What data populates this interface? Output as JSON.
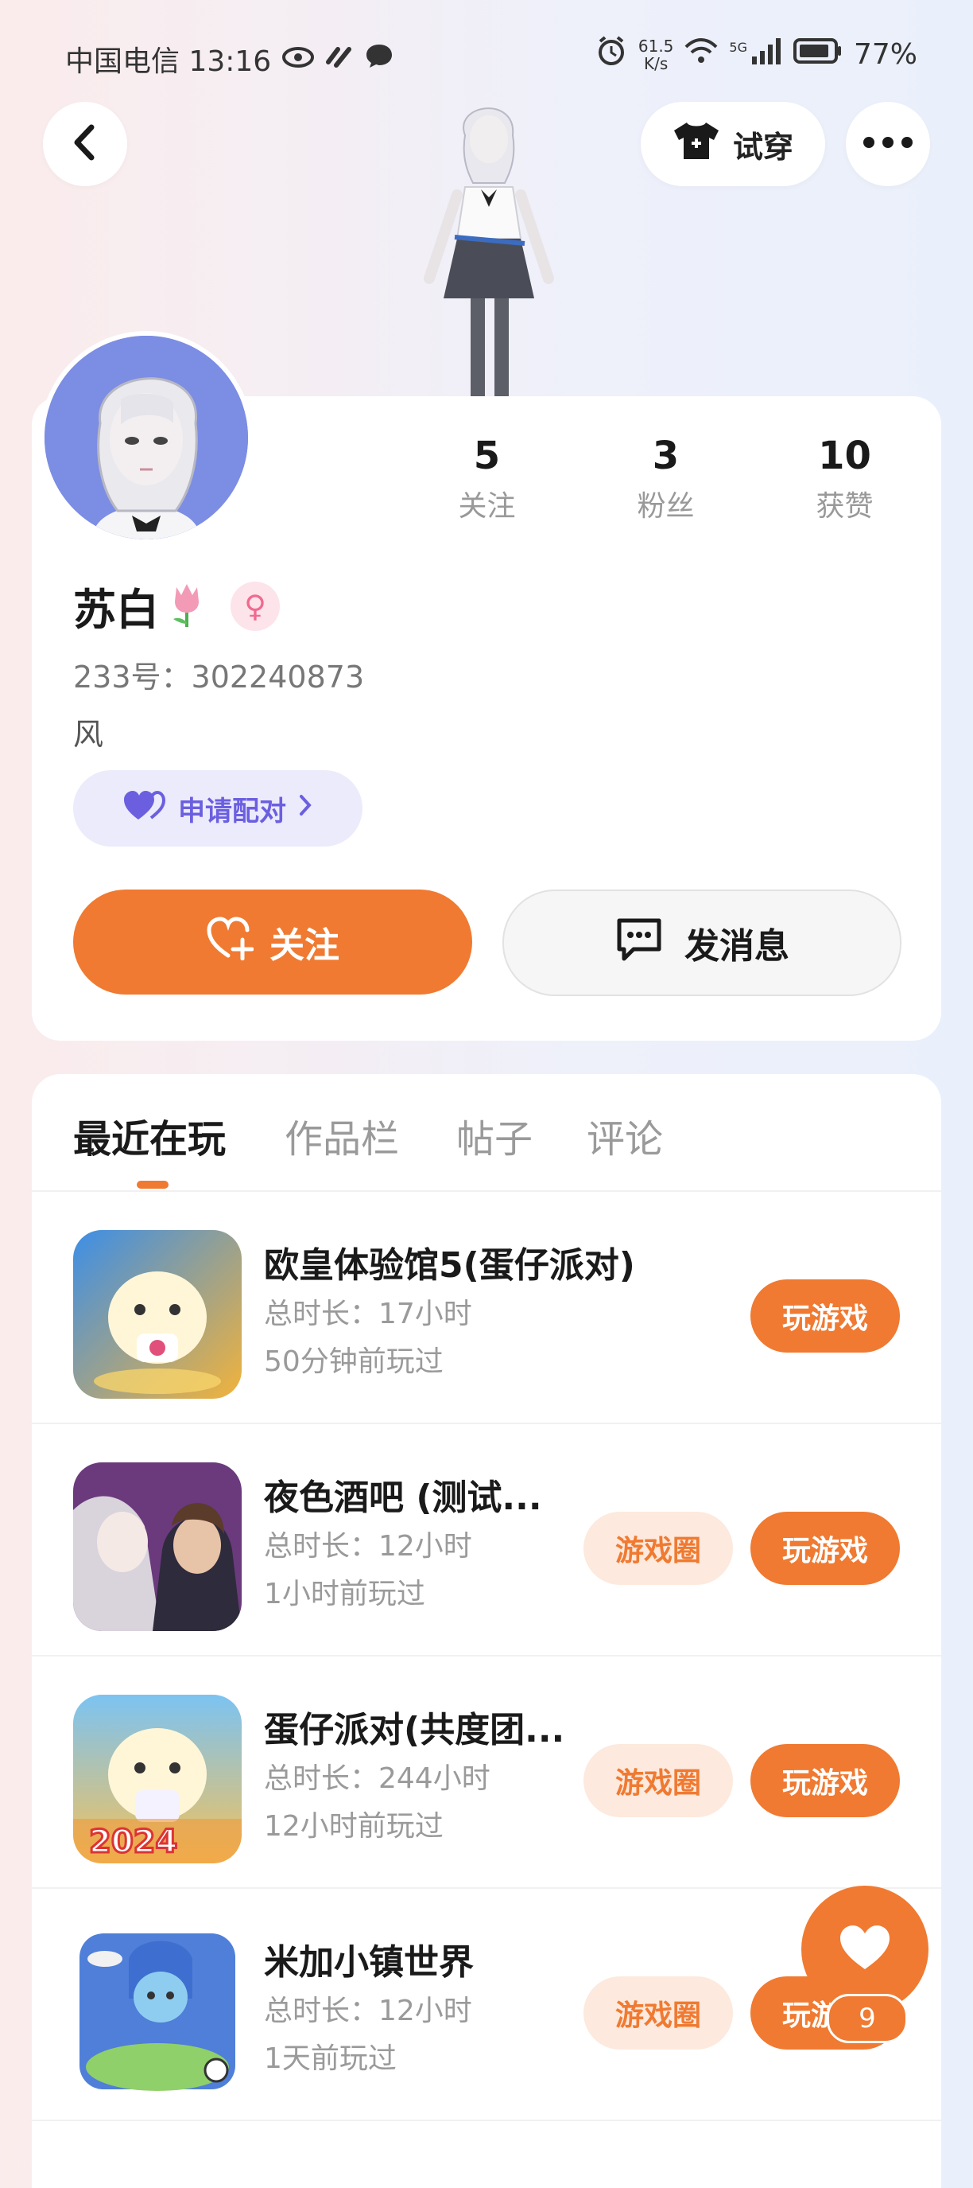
{
  "status_bar": {
    "carrier_time": "中国电信 13:16",
    "net_speed_value": "61.5",
    "net_speed_unit": "K/s",
    "signal_label": "5G",
    "battery": "77%"
  },
  "header": {
    "tryon_label": "试穿"
  },
  "profile": {
    "stats": [
      {
        "value": "5",
        "label": "关注"
      },
      {
        "value": "3",
        "label": "粉丝"
      },
      {
        "value": "10",
        "label": "获赞"
      }
    ],
    "name": "苏白",
    "gender_symbol": "♀",
    "uid": "233号：302240873",
    "bio": "风",
    "pair_label": "申请配对",
    "follow_label": "关注",
    "message_label": "发消息"
  },
  "tabs": [
    {
      "label": "最近在玩",
      "active": true
    },
    {
      "label": "作品栏",
      "active": false
    },
    {
      "label": "帖子",
      "active": false
    },
    {
      "label": "评论",
      "active": false
    }
  ],
  "games": [
    {
      "title": "欧皇体验馆5(蛋仔派对)",
      "duration": "总时长：17小时",
      "last_played": "50分钟前玩过",
      "circle_label": "",
      "play_label": "玩游戏"
    },
    {
      "title": "夜色酒吧 (测试...",
      "duration": "总时长：12小时",
      "last_played": "1小时前玩过",
      "circle_label": "游戏圈",
      "play_label": "玩游戏"
    },
    {
      "title": "蛋仔派对(共度团...",
      "duration": "总时长：244小时",
      "last_played": "12小时前玩过",
      "circle_label": "游戏圈",
      "play_label": "玩游戏"
    },
    {
      "title": "米加小镇世界",
      "duration": "总时长：12小时",
      "last_played": "1天前玩过",
      "circle_label": "游戏圈",
      "play_label": "玩游戏"
    }
  ],
  "game3_icon_text": "2024",
  "fab": {
    "count": "9"
  },
  "colors": {
    "accent": "#f07a31",
    "pair": "#6b5fe0",
    "soft_accent": "#fde9dd"
  }
}
